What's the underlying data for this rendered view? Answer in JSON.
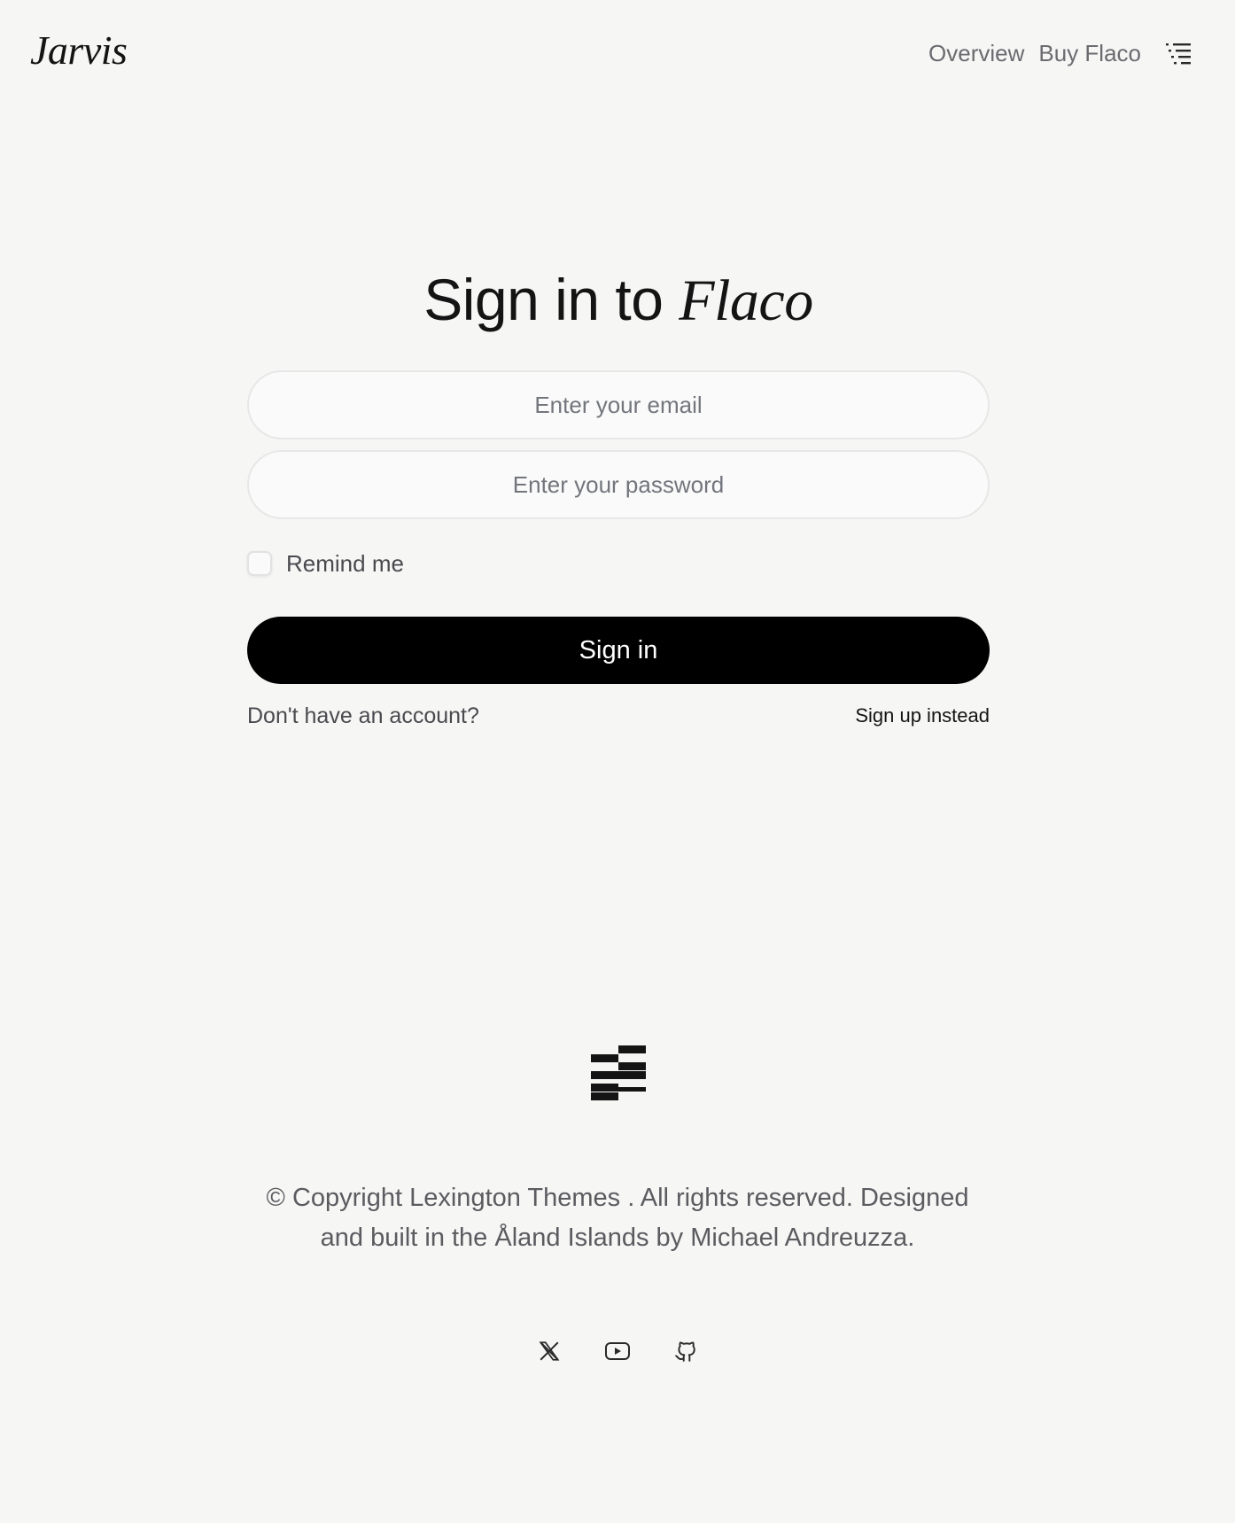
{
  "header": {
    "brand": "Jarvis",
    "nav": {
      "overview": "Overview",
      "buy": "Buy Flaco"
    },
    "menu_icon": "menu-icon"
  },
  "form": {
    "title_prefix": "Sign in to",
    "title_accent": "Flaco",
    "email": {
      "value": "",
      "placeholder": "Enter your email"
    },
    "password": {
      "value": "",
      "placeholder": "Enter your password"
    },
    "remember_label": "Remind me",
    "remember_checked": false,
    "submit_label": "Sign in",
    "signup_prompt": "Don't have an account?",
    "signup_link": "Sign up instead"
  },
  "footer": {
    "logo_icon": "stacked-bars-logo-icon",
    "copyright_line1": "© Copyright Lexington Themes . All rights reserved. Designed",
    "copyright_line2": "and built in the Åland Islands by Michael Andreuzza.",
    "socials": [
      "x-icon",
      "youtube-icon",
      "github-icon"
    ]
  },
  "colors": {
    "background": "#f6f6f5",
    "text": "#141414",
    "muted": "#6b6b70",
    "button": "#000000",
    "button_text": "#ffffff",
    "input_border": "#e7e7e7"
  }
}
